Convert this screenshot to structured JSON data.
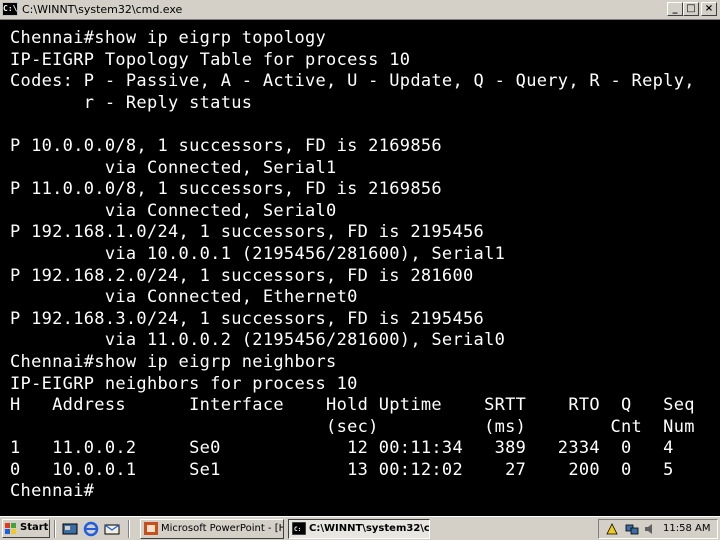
{
  "window": {
    "title": "C:\\WINNT\\system32\\cmd.exe",
    "icon_label": "C:\\",
    "buttons": {
      "minimize": "_",
      "maximize": "□",
      "close": "×"
    }
  },
  "console": {
    "lines": [
      "Chennai#show ip eigrp topology",
      "IP-EIGRP Topology Table for process 10",
      "Codes: P - Passive, A - Active, U - Update, Q - Query, R - Reply,",
      "       r - Reply status",
      "",
      "P 10.0.0.0/8, 1 successors, FD is 2169856",
      "         via Connected, Serial1",
      "P 11.0.0.0/8, 1 successors, FD is 2169856",
      "         via Connected, Serial0",
      "P 192.168.1.0/24, 1 successors, FD is 2195456",
      "         via 10.0.0.1 (2195456/281600), Serial1",
      "P 192.168.2.0/24, 1 successors, FD is 281600",
      "         via Connected, Ethernet0",
      "P 192.168.3.0/24, 1 successors, FD is 2195456",
      "         via 11.0.0.2 (2195456/281600), Serial0",
      "Chennai#show ip eigrp neighbors",
      "IP-EIGRP neighbors for process 10",
      "H   Address      Interface    Hold Uptime    SRTT    RTO  Q   Seq",
      "                              (sec)          (ms)        Cnt  Num",
      "1   11.0.0.2     Se0            12 00:11:34   389   2334  0   4",
      "0   10.0.0.1     Se1            13 00:12:02    27    200  0   5",
      "Chennai#"
    ]
  },
  "taskbar": {
    "start_label": "Start",
    "tasks": [
      {
        "label": "Microsoft PowerPoint - [H...",
        "active": false
      },
      {
        "label": "C:\\WINNT\\system32\\c...",
        "active": true
      }
    ],
    "clock": "11:58 AM"
  },
  "colors": {
    "console_bg": "#000000",
    "console_fg": "#ffffff",
    "chrome": "#d4d0c8"
  }
}
